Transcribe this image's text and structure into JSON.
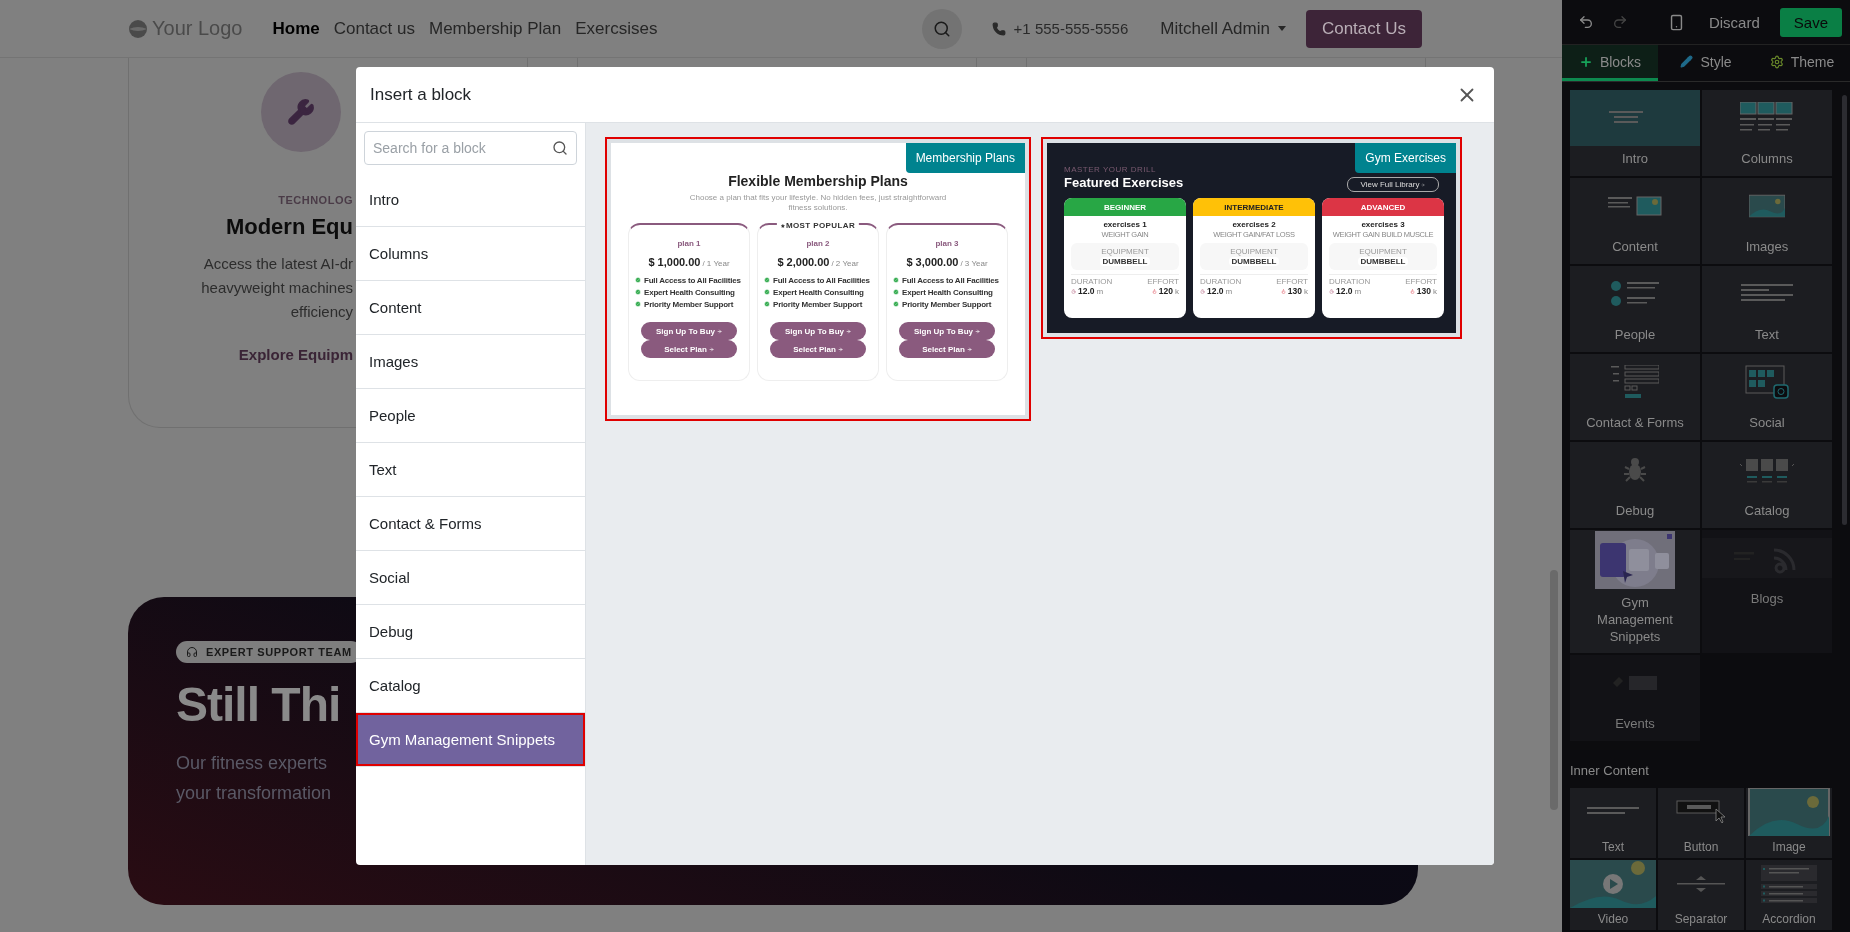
{
  "page": {
    "nav": {
      "logo": "Your Logo",
      "links": [
        {
          "label": "Home",
          "selected": true
        },
        {
          "label": "Contact us",
          "selected": false
        },
        {
          "label": "Membership Plan",
          "selected": false
        },
        {
          "label": "Exercsises",
          "selected": false
        }
      ],
      "phone": "+1 555-555-5556",
      "user": "Mitchell Admin",
      "cta": "Contact Us"
    },
    "feature_card": {
      "eyebrow": "TECHNOLOG",
      "title": "Modern Equ",
      "body_lines": [
        "Access the latest AI-dr",
        "heavyweight machines",
        "efficiency"
      ],
      "link": "Explore Equipm"
    },
    "support_banner": {
      "badge": "EXPERT SUPPORT TEAM",
      "title": "Still Thi",
      "lines": [
        "Our fitness experts",
        "your transformation"
      ]
    }
  },
  "modal": {
    "title": "Insert a block",
    "search": {
      "placeholder": "Search for a block"
    },
    "categories": [
      {
        "label": "Intro",
        "selected": false
      },
      {
        "label": "Columns",
        "selected": false
      },
      {
        "label": "Content",
        "selected": false
      },
      {
        "label": "Images",
        "selected": false
      },
      {
        "label": "People",
        "selected": false
      },
      {
        "label": "Text",
        "selected": false
      },
      {
        "label": "Contact & Forms",
        "selected": false
      },
      {
        "label": "Social",
        "selected": false
      },
      {
        "label": "Debug",
        "selected": false
      },
      {
        "label": "Catalog",
        "selected": false
      },
      {
        "label": "Gym Management Snippets",
        "selected": true
      }
    ],
    "previews": [
      {
        "kind": "membership",
        "badge": "Membership Plans",
        "title": "Flexible Membership Plans",
        "subtitle": "Choose a plan that fits your lifestyle. No hidden fees, just straightforward fitness solutions.",
        "plans": [
          {
            "name": "plan 1",
            "price": "$ 1,000.00",
            "period": "/ 1 Year",
            "features": [
              "Full Access to All Facilities",
              "Expert Health Consulting",
              "Priority Member Support"
            ],
            "buttons": [
              "Sign Up To Buy",
              "Select Plan"
            ]
          },
          {
            "name": "plan 2",
            "tag": "MOST POPULAR",
            "price": "$ 2,000.00",
            "period": "/ 2 Year",
            "features": [
              "Full Access to All Facilities",
              "Expert Health Consulting",
              "Priority Member Support"
            ],
            "buttons": [
              "Sign Up To Buy",
              "Select Plan"
            ]
          },
          {
            "name": "plan 3",
            "price": "$ 3,000.00",
            "period": "/ 3 Year",
            "features": [
              "Full Access to All Facilities",
              "Expert Health Consulting",
              "Priority Member Support"
            ],
            "buttons": [
              "Sign Up To Buy",
              "Select Plan"
            ]
          }
        ]
      },
      {
        "kind": "exercises",
        "badge": "Gym Exercises",
        "eyebrow": "MASTER YOUR DRILL",
        "title": "Featured Exercises",
        "button": "View Full Library",
        "cards": [
          {
            "level": "BEGINNER",
            "color": "#28a745",
            "name": "exercises 1",
            "goal": "WEIGHT GAIN",
            "equipment_label": "EQUIPMENT",
            "equipment": "DUMBBELL",
            "duration_label": "DURATION",
            "duration": "12.0",
            "duration_unit": "m",
            "effort_label": "EFFORT",
            "effort": "120",
            "effort_unit": "k"
          },
          {
            "level": "INTERMEDIATE",
            "color": "#ffc107",
            "name": "exercises 2",
            "goal": "WEIGHT GAIN/FAT LOSS",
            "equipment_label": "EQUIPMENT",
            "equipment": "DUMBBELL",
            "duration_label": "DURATION",
            "duration": "12.0",
            "duration_unit": "m",
            "effort_label": "EFFORT",
            "effort": "130",
            "effort_unit": "k"
          },
          {
            "level": "ADVANCED",
            "color": "#dc3545",
            "name": "exercises 3",
            "goal": "WEIGHT GAIN BUILD MUSCLE",
            "equipment_label": "EQUIPMENT",
            "equipment": "DUMBBELL",
            "duration_label": "DURATION",
            "duration": "12.0",
            "duration_unit": "m",
            "effort_label": "EFFORT",
            "effort": "130",
            "effort_unit": "k"
          }
        ]
      }
    ]
  },
  "sidebar": {
    "discard": "Discard",
    "save": "Save",
    "tabs": [
      {
        "label": "Blocks",
        "selected": true
      },
      {
        "label": "Style",
        "selected": false
      },
      {
        "label": "Theme",
        "selected": false
      }
    ],
    "blocks": [
      {
        "label": "Intro",
        "highlighted": true,
        "disabled": false
      },
      {
        "label": "Columns",
        "highlighted": false,
        "disabled": false
      },
      {
        "label": "Content",
        "highlighted": false,
        "disabled": false
      },
      {
        "label": "Images",
        "highlighted": false,
        "disabled": false
      },
      {
        "label": "People",
        "highlighted": false,
        "disabled": false
      },
      {
        "label": "Text",
        "highlighted": false,
        "disabled": false
      },
      {
        "label": "Contact & Forms",
        "highlighted": false,
        "disabled": false
      },
      {
        "label": "Social",
        "highlighted": false,
        "disabled": false
      },
      {
        "label": "Debug",
        "highlighted": false,
        "disabled": false
      },
      {
        "label": "Catalog",
        "highlighted": false,
        "disabled": false
      },
      {
        "label": "Gym Management Snippets",
        "highlighted": false,
        "disabled": false
      },
      {
        "label": "Blogs",
        "highlighted": false,
        "disabled": true
      },
      {
        "label": "Events",
        "highlighted": false,
        "disabled": true
      }
    ],
    "inner_title": "Inner Content",
    "inner_items": [
      {
        "label": "Text"
      },
      {
        "label": "Button"
      },
      {
        "label": "Image"
      },
      {
        "label": "Video"
      },
      {
        "label": "Separator"
      },
      {
        "label": "Accordion"
      }
    ]
  }
}
